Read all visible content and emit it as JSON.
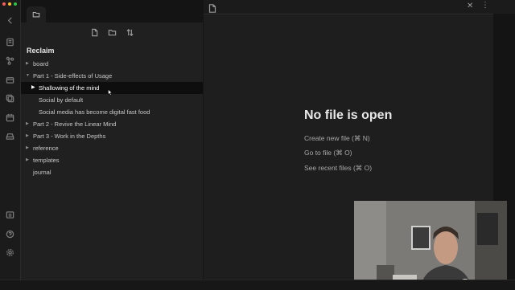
{
  "colors": {
    "background": "#141414",
    "sidebar": "#202020",
    "main": "#1e1e1e",
    "active_row": "#0e0e0e",
    "traffic_close": "#ff5f57",
    "traffic_min": "#febc2e",
    "traffic_max": "#28c840"
  },
  "ribbon": {
    "icons": [
      "switcher-icon",
      "graph-view-icon",
      "slides-icon",
      "templates-icon",
      "daily-note-icon",
      "command-palette-icon",
      "open-vault-icon",
      "help-icon",
      "settings-icon"
    ]
  },
  "sidebar": {
    "tab_icon": "folder-icon",
    "nav_icons": [
      "new-note-icon",
      "new-folder-icon",
      "sort-icon"
    ],
    "vault_name": "Reclaim",
    "tree": [
      {
        "label": "board",
        "type": "folder",
        "expanded": false
      },
      {
        "label": "Part 1 - Side-effects of Usage",
        "type": "folder",
        "expanded": true
      },
      {
        "label": "Shallowing of the mind",
        "type": "folder",
        "expanded": false,
        "active": true
      },
      {
        "label": "Social by default",
        "type": "file"
      },
      {
        "label": "Social media has become digital fast food",
        "type": "file"
      },
      {
        "label": "Part 2 - Revive the Linear Mind",
        "type": "folder",
        "expanded": false
      },
      {
        "label": "Part 3 - Work in the Depths",
        "type": "folder",
        "expanded": false
      },
      {
        "label": "reference",
        "type": "folder",
        "expanded": false
      },
      {
        "label": "templates",
        "type": "folder",
        "expanded": false
      },
      {
        "label": "journal",
        "type": "file"
      }
    ]
  },
  "main": {
    "empty_title": "No file is open",
    "actions": [
      {
        "label": "Create new file (⌘ N)"
      },
      {
        "label": "Go to file (⌘ O)"
      },
      {
        "label": "See recent files (⌘ O)"
      }
    ]
  }
}
